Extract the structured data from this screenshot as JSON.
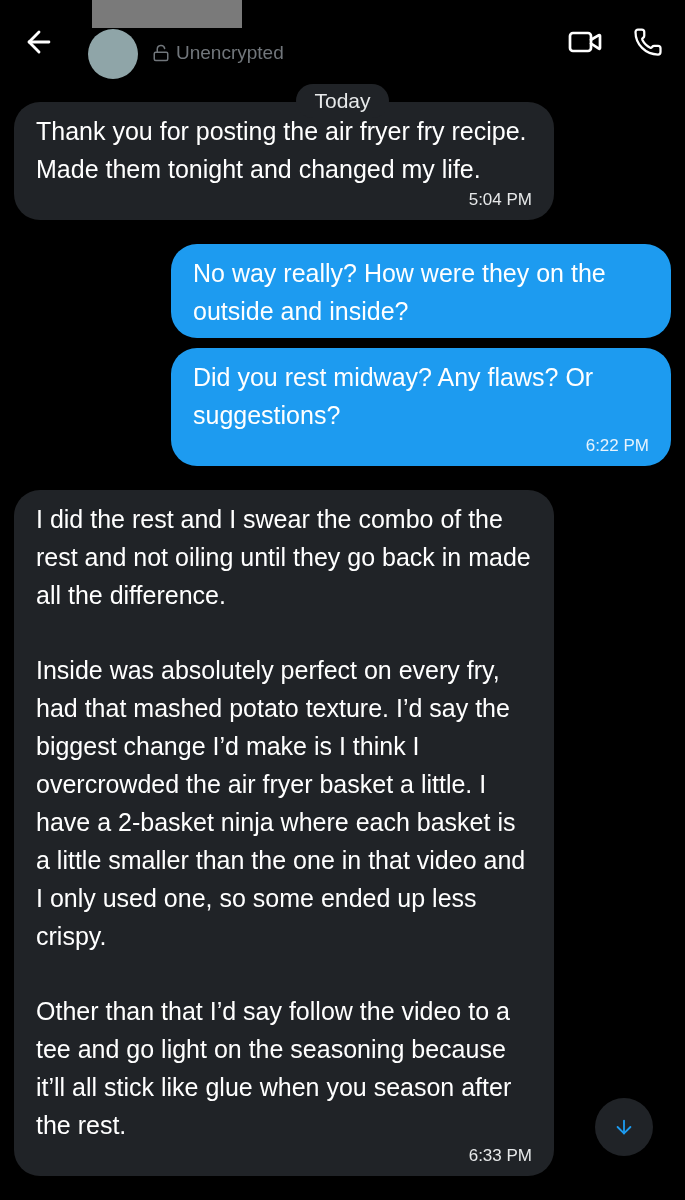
{
  "header": {
    "status": "Unencrypted"
  },
  "date_divider": "Today",
  "messages": [
    {
      "kind": "incoming",
      "paragraphs": [
        "Thank you for posting the air fryer fry recipe. Made them tonight and changed my life."
      ],
      "time": "5:04 PM"
    },
    {
      "kind": "outgoing",
      "paragraphs": [
        "No way really? How were they on the outside and inside?"
      ]
    },
    {
      "kind": "outgoing",
      "paragraphs": [
        "Did you rest midway? Any flaws? Or suggestions?"
      ],
      "time": "6:22 PM"
    },
    {
      "kind": "incoming",
      "paragraphs": [
        "I did the rest and I swear the combo of the rest and not oiling until they go back in made all the difference.",
        "Inside was absolutely perfect on every fry, had that mashed potato texture. I’d say the biggest change I’d make is I think I overcrowded the air fryer basket a little. I have a 2-basket ninja where each basket is a little smaller than the one in that video and I only used one, so some ended up less crispy.",
        "Other than that I’d say follow the video to a tee and go light on the seasoning because it’ll all stick like glue when you season after the rest."
      ],
      "time": "6:33 PM"
    }
  ]
}
